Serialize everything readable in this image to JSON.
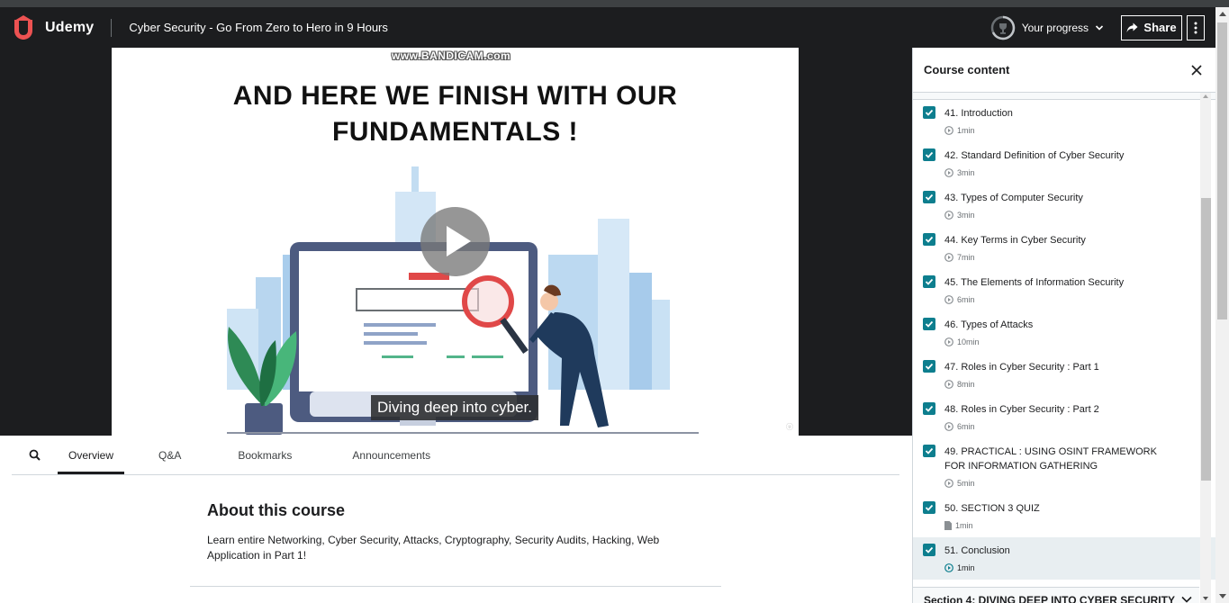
{
  "header": {
    "logo_text": "Udemy",
    "course_title": "Cyber Security - Go From Zero to Hero in 9 Hours",
    "progress_label": "Your progress",
    "share_label": "Share"
  },
  "video": {
    "watermark": "www.BANDICAM.com",
    "slide_title_line1": "AND HERE WE FINISH WITH OUR",
    "slide_title_line2": "FUNDAMENTALS !",
    "caption": "Diving deep into cyber."
  },
  "tabs": {
    "overview": "Overview",
    "qa": "Q&A",
    "bookmarks": "Bookmarks",
    "announcements": "Announcements"
  },
  "about": {
    "title": "About this course",
    "description": "Learn entire Networking, Cyber Security, Attacks, Cryptography, Security Audits, Hacking, Web Application in Part 1!"
  },
  "sidebar": {
    "title": "Course content",
    "lectures": [
      {
        "title": "41. Introduction",
        "duration": "1min",
        "type": "video"
      },
      {
        "title": "42. Standard Definition of Cyber Security",
        "duration": "3min",
        "type": "video"
      },
      {
        "title": "43. Types of Computer Security",
        "duration": "3min",
        "type": "video"
      },
      {
        "title": "44. Key Terms in Cyber Security",
        "duration": "7min",
        "type": "video"
      },
      {
        "title": "45. The Elements of Information Security",
        "duration": "6min",
        "type": "video"
      },
      {
        "title": "46. Types of Attacks",
        "duration": "10min",
        "type": "video"
      },
      {
        "title": "47. Roles in Cyber Security : Part 1",
        "duration": "8min",
        "type": "video"
      },
      {
        "title": "48. Roles in Cyber Security : Part 2",
        "duration": "6min",
        "type": "video"
      },
      {
        "title": "49. PRACTICAL : USING OSINT FRAMEWORK FOR INFORMATION GATHERING",
        "duration": "5min",
        "type": "video"
      },
      {
        "title": "50. SECTION 3 QUIZ",
        "duration": "1min",
        "type": "quiz"
      },
      {
        "title": "51. Conclusion",
        "duration": "1min",
        "type": "video",
        "current": true
      }
    ],
    "next_section": "Section 4: DIVING DEEP INTO CYBER SECURITY"
  },
  "colors": {
    "header_bg": "#1c1d1f",
    "checkbox": "#0d7e8e",
    "current_row": "#e8eef1",
    "brand": "#ec5252"
  }
}
